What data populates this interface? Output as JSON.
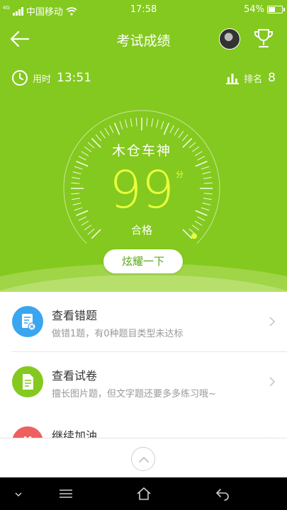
{
  "status_bar": {
    "network": "4G",
    "carrier": "中国移动",
    "time": "17:58",
    "battery": "54%",
    "battery_level": 0.54
  },
  "header": {
    "title": "考试成绩"
  },
  "stats": {
    "duration_label": "用时",
    "duration_value": "13:51",
    "rank_label": "排名",
    "rank_value": "8"
  },
  "score_card": {
    "name": "木仓车神",
    "score": "99",
    "unit": "分",
    "status": "合格",
    "score_fraction": 0.99,
    "show_off_button": "炫耀一下"
  },
  "actions": [
    {
      "title": "查看错题",
      "subtitle": "做错1题，有0种题目类型未达标",
      "color": "#3aa6f0",
      "icon": "mistakes-icon"
    },
    {
      "title": "查看试卷",
      "subtitle": "擅长图片题，但文字题还要多多练习哦~",
      "color": "#84c91f",
      "icon": "paper-icon"
    },
    {
      "title": "继续加油",
      "subtitle": "",
      "color": "#f06060",
      "icon": "gift-icon"
    }
  ],
  "colors": {
    "brand_green": "#84c91f",
    "score_yellow": "#e8ff3c"
  }
}
